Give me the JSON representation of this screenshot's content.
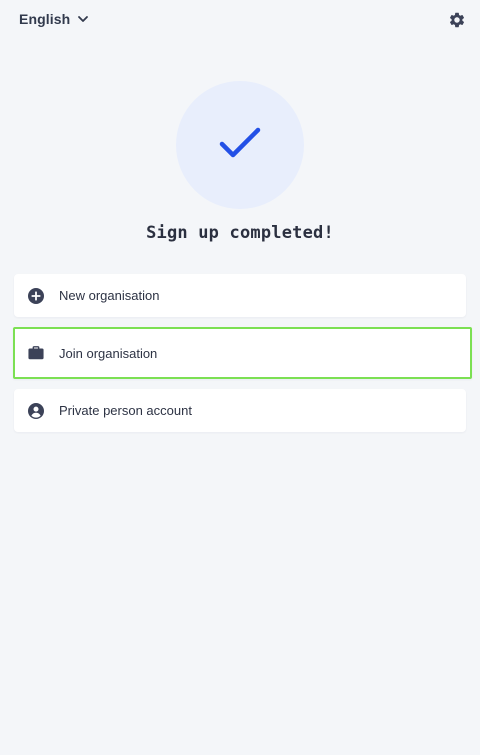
{
  "header": {
    "language": "English",
    "language_icon": "chevron-down-icon",
    "settings_icon": "gear-icon"
  },
  "status": {
    "icon": "checkmark-icon",
    "title": "Sign up completed!"
  },
  "options": [
    {
      "label": "New organisation",
      "icon": "plus-circle-icon"
    },
    {
      "label": "Join organisation",
      "icon": "briefcase-icon"
    },
    {
      "label": "Private person account",
      "icon": "user-circle-icon"
    }
  ],
  "colors": {
    "background": "#f4f6f9",
    "accent": "#2350e6",
    "success_circle_bg": "#e8eefc",
    "highlight_border": "#7ce053",
    "icon_color": "#3c4258"
  }
}
